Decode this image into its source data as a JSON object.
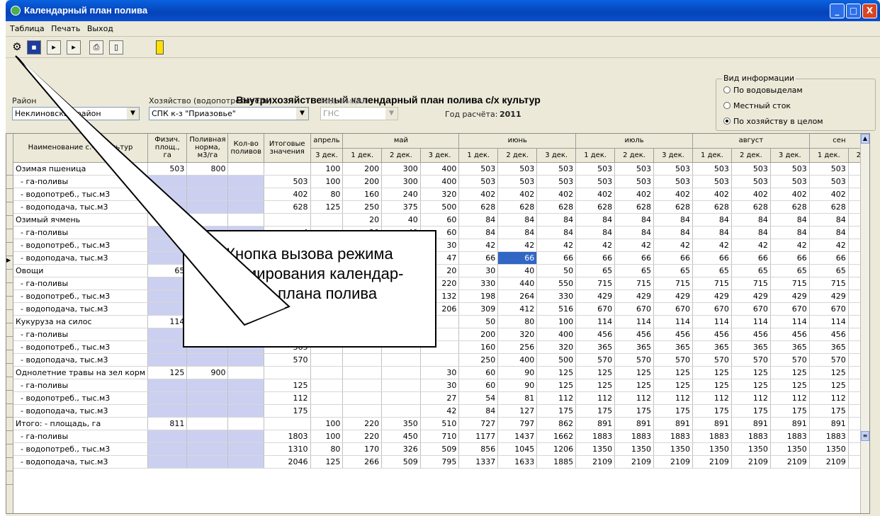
{
  "window": {
    "title": "Календарный план полива",
    "min": "_",
    "max": "□",
    "close": "X"
  },
  "menu": [
    "Таблица",
    "Печать",
    "Выход"
  ],
  "toolbar_icons": [
    "wizard-icon",
    "save-icon",
    "next-icon",
    "last-icon",
    "print-icon",
    "new-document-icon",
    "exit-door-icon"
  ],
  "heading": "Внутрихозяйственный календарный план полива с/х культур",
  "filters": {
    "district_label": "Район",
    "district_value": "Неклиновский район",
    "farm_label": "Хозяйство (водопотребитель)",
    "farm_value": "СПК к-з \"Приазовье\"",
    "water_label": "Водовыдел",
    "water_value": "ГНС",
    "year_label": "Год расчёта:",
    "year_value": "2011"
  },
  "info_group": {
    "title": "Вид информации",
    "options": [
      "По водовыделам",
      "Местный сток",
      "По хозяйству в целом"
    ],
    "selected": 2
  },
  "headers": {
    "name": "Наименование с.-х. культур",
    "area": "Физич. площ., га",
    "norm": "Поливная норма, м3/га",
    "count": "Кол-во поливов",
    "total": "Итоговые значения",
    "months": [
      {
        "label": "апрель",
        "span": 1
      },
      {
        "label": "май",
        "span": 3
      },
      {
        "label": "июнь",
        "span": 3
      },
      {
        "label": "июль",
        "span": 3
      },
      {
        "label": "август",
        "span": 3
      },
      {
        "label": "сен",
        "span": 2
      }
    ],
    "decades": [
      "3 дек.",
      "1 дек.",
      "2 дек.",
      "3 дек.",
      "1 дек.",
      "2 дек.",
      "3 дек.",
      "1 дек.",
      "2 дек.",
      "3 дек.",
      "1 дек.",
      "2 дек.",
      "3 дек.",
      "1 дек.",
      "2"
    ]
  },
  "rows": [
    {
      "name": "Озимая пшеница",
      "sub": false,
      "area": "503",
      "norm": "800",
      "count": "",
      "total": "",
      "vals": [
        "100",
        "200",
        "300",
        "400",
        "503",
        "503",
        "503",
        "503",
        "503",
        "503",
        "503",
        "503",
        "503",
        "503",
        ""
      ]
    },
    {
      "name": "- га-поливы",
      "sub": true,
      "area": "",
      "norm": "",
      "count": "",
      "total": "503",
      "vals": [
        "100",
        "200",
        "300",
        "400",
        "503",
        "503",
        "503",
        "503",
        "503",
        "503",
        "503",
        "503",
        "503",
        "503",
        ""
      ]
    },
    {
      "name": "- водопотреб., тыс.м3",
      "sub": true,
      "area": "",
      "norm": "",
      "count": "",
      "total": "402",
      "vals": [
        "80",
        "160",
        "240",
        "320",
        "402",
        "402",
        "402",
        "402",
        "402",
        "402",
        "402",
        "402",
        "402",
        "402",
        ""
      ]
    },
    {
      "name": "- водоподача, тыс.м3",
      "sub": true,
      "area": "",
      "norm": "",
      "count": "",
      "total": "628",
      "vals": [
        "125",
        "250",
        "375",
        "500",
        "628",
        "628",
        "628",
        "628",
        "628",
        "628",
        "628",
        "628",
        "628",
        "628",
        ""
      ]
    },
    {
      "name": "Озимый ячмень",
      "sub": false,
      "area": "4",
      "norm": "",
      "count": "",
      "total": "",
      "vals": [
        "",
        "20",
        "40",
        "60",
        "84",
        "84",
        "84",
        "84",
        "84",
        "84",
        "84",
        "84",
        "84",
        "84",
        ""
      ]
    },
    {
      "name": "- га-поливы",
      "sub": true,
      "area": "",
      "norm": "",
      "count": "",
      "total": "4",
      "vals": [
        "",
        "20",
        "40",
        "60",
        "84",
        "84",
        "84",
        "84",
        "84",
        "84",
        "84",
        "84",
        "84",
        "84",
        ""
      ]
    },
    {
      "name": "- водопотреб., тыс.м3",
      "sub": true,
      "area": "",
      "norm": "",
      "count": "",
      "total": "2",
      "vals": [
        "",
        "10",
        "20",
        "30",
        "42",
        "42",
        "42",
        "42",
        "42",
        "42",
        "42",
        "42",
        "42",
        "42",
        ""
      ]
    },
    {
      "name": "- водоподача, тыс.м3",
      "sub": true,
      "area": "",
      "norm": "",
      "count": "",
      "total": "",
      "vals": [
        "",
        "",
        "",
        "47",
        "66",
        "66",
        "66",
        "66",
        "66",
        "66",
        "66",
        "66",
        "66",
        "66",
        ""
      ],
      "sel": 5
    },
    {
      "name": "Овощи",
      "sub": false,
      "area": "65",
      "norm": "",
      "count": "",
      "total": "",
      "vals": [
        "",
        "",
        "",
        "20",
        "30",
        "40",
        "50",
        "65",
        "65",
        "65",
        "65",
        "65",
        "65",
        "65",
        ""
      ]
    },
    {
      "name": "- га-поливы",
      "sub": true,
      "area": "",
      "norm": "",
      "count": "",
      "total": "",
      "vals": [
        "",
        "",
        "",
        "220",
        "330",
        "440",
        "550",
        "715",
        "715",
        "715",
        "715",
        "715",
        "715",
        "715",
        ""
      ]
    },
    {
      "name": "- водопотреб., тыс.м3",
      "sub": true,
      "area": "",
      "norm": "",
      "count": "",
      "total": "",
      "vals": [
        "",
        "",
        "",
        "132",
        "198",
        "264",
        "330",
        "429",
        "429",
        "429",
        "429",
        "429",
        "429",
        "429",
        ""
      ]
    },
    {
      "name": "- водоподача, тыс.м3",
      "sub": true,
      "area": "",
      "norm": "",
      "count": "",
      "total": "",
      "vals": [
        "",
        "",
        "",
        "206",
        "309",
        "412",
        "516",
        "670",
        "670",
        "670",
        "670",
        "670",
        "670",
        "670",
        ""
      ]
    },
    {
      "name": "Кукуруза на силос",
      "sub": false,
      "area": "114",
      "norm": "",
      "count": "",
      "total": "",
      "vals": [
        "",
        "",
        "",
        "",
        "50",
        "80",
        "100",
        "114",
        "114",
        "114",
        "114",
        "114",
        "114",
        "114",
        ""
      ]
    },
    {
      "name": "- га-поливы",
      "sub": true,
      "area": "",
      "norm": "",
      "count": "",
      "total": "456",
      "vals": [
        "",
        "",
        "",
        "",
        "200",
        "320",
        "400",
        "456",
        "456",
        "456",
        "456",
        "456",
        "456",
        "456",
        ""
      ]
    },
    {
      "name": "- водопотреб., тыс.м3",
      "sub": true,
      "area": "",
      "norm": "",
      "count": "",
      "total": "365",
      "vals": [
        "",
        "",
        "",
        "",
        "160",
        "256",
        "320",
        "365",
        "365",
        "365",
        "365",
        "365",
        "365",
        "365",
        ""
      ]
    },
    {
      "name": "- водоподача, тыс.м3",
      "sub": true,
      "area": "",
      "norm": "",
      "count": "",
      "total": "570",
      "vals": [
        "",
        "",
        "",
        "",
        "250",
        "400",
        "500",
        "570",
        "570",
        "570",
        "570",
        "570",
        "570",
        "570",
        ""
      ]
    },
    {
      "name": "Однолетние травы на зел корм",
      "sub": false,
      "area": "125",
      "norm": "900",
      "count": "",
      "total": "",
      "vals": [
        "",
        "",
        "",
        "30",
        "60",
        "90",
        "125",
        "125",
        "125",
        "125",
        "125",
        "125",
        "125",
        "125",
        ""
      ]
    },
    {
      "name": "- га-поливы",
      "sub": true,
      "area": "",
      "norm": "",
      "count": "",
      "total": "125",
      "vals": [
        "",
        "",
        "",
        "30",
        "60",
        "90",
        "125",
        "125",
        "125",
        "125",
        "125",
        "125",
        "125",
        "125",
        ""
      ]
    },
    {
      "name": "- водопотреб., тыс.м3",
      "sub": true,
      "area": "",
      "norm": "",
      "count": "",
      "total": "112",
      "vals": [
        "",
        "",
        "",
        "27",
        "54",
        "81",
        "112",
        "112",
        "112",
        "112",
        "112",
        "112",
        "112",
        "112",
        ""
      ]
    },
    {
      "name": "- водоподача, тыс.м3",
      "sub": true,
      "area": "",
      "norm": "",
      "count": "",
      "total": "175",
      "vals": [
        "",
        "",
        "",
        "42",
        "84",
        "127",
        "175",
        "175",
        "175",
        "175",
        "175",
        "175",
        "175",
        "175",
        ""
      ]
    },
    {
      "name": "Итого: - площадь, га",
      "sub": false,
      "area": "811",
      "norm": "",
      "count": "",
      "total": "",
      "vals": [
        "100",
        "220",
        "350",
        "510",
        "727",
        "797",
        "862",
        "891",
        "891",
        "891",
        "891",
        "891",
        "891",
        "891",
        ""
      ]
    },
    {
      "name": "- га-поливы",
      "sub": true,
      "area": "",
      "norm": "",
      "count": "",
      "total": "1803",
      "vals": [
        "100",
        "220",
        "450",
        "710",
        "1177",
        "1437",
        "1662",
        "1883",
        "1883",
        "1883",
        "1883",
        "1883",
        "1883",
        "1883",
        ""
      ]
    },
    {
      "name": "- водопотреб., тыс.м3",
      "sub": true,
      "area": "",
      "norm": "",
      "count": "",
      "total": "1310",
      "vals": [
        "80",
        "170",
        "326",
        "509",
        "856",
        "1045",
        "1206",
        "1350",
        "1350",
        "1350",
        "1350",
        "1350",
        "1350",
        "1350",
        ""
      ]
    },
    {
      "name": "- водоподача, тыс.м3",
      "sub": true,
      "area": "",
      "norm": "",
      "count": "",
      "total": "2046",
      "vals": [
        "125",
        "266",
        "509",
        "795",
        "1337",
        "1633",
        "1885",
        "2109",
        "2109",
        "2109",
        "2109",
        "2109",
        "2109",
        "2109",
        ""
      ]
    }
  ],
  "callout": {
    "lines": [
      "Кнопка вызова режима",
      "формирования календар-",
      "ного плана полива"
    ]
  }
}
